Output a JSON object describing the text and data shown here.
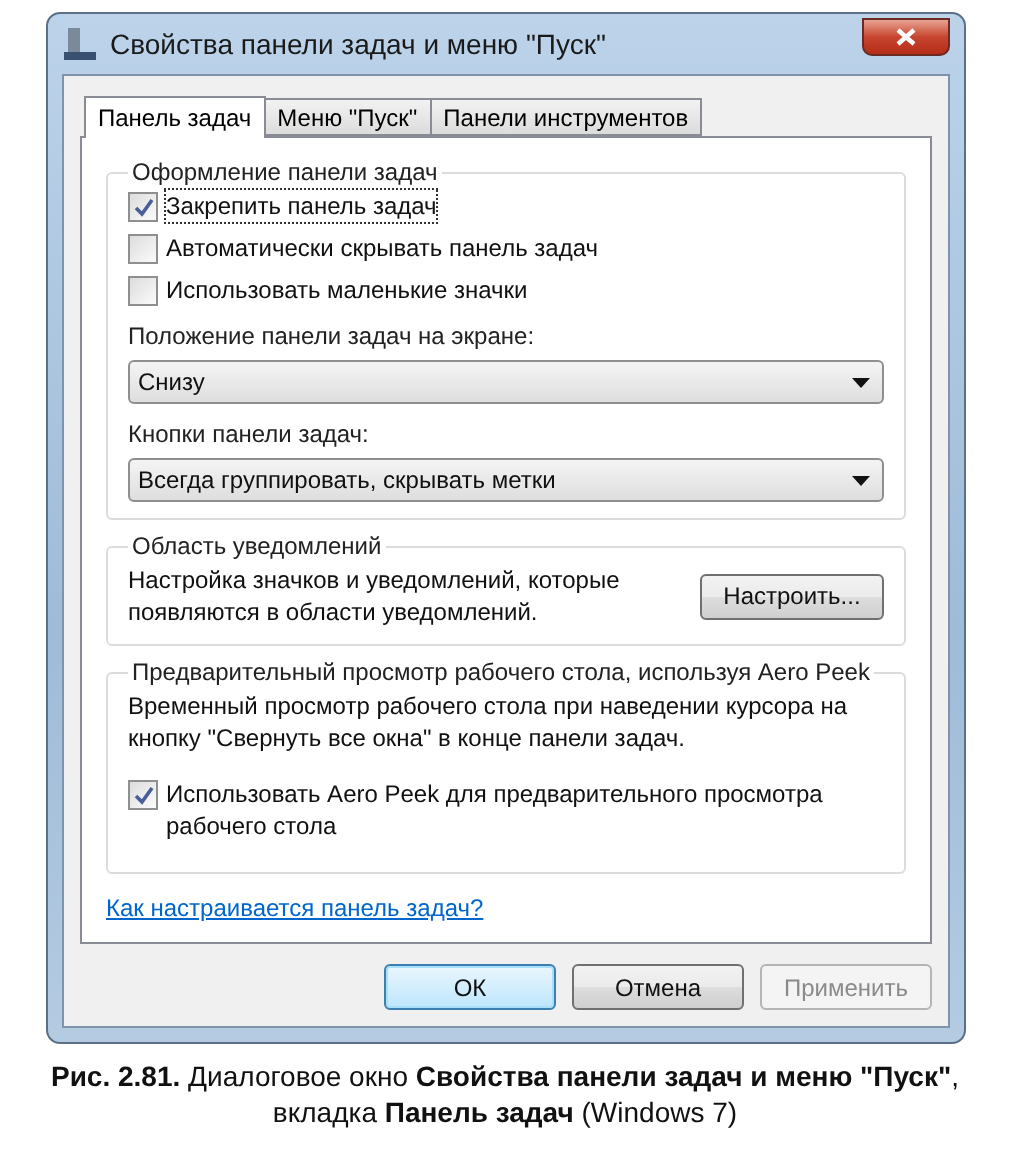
{
  "window": {
    "title": "Свойства панели задач и меню \"Пуск\""
  },
  "tabs": [
    {
      "label": "Панель задач",
      "selected": true
    },
    {
      "label": "Меню \"Пуск\"",
      "selected": false
    },
    {
      "label": "Панели инструментов",
      "selected": false
    }
  ],
  "appearance": {
    "title": "Оформление панели задач",
    "checkboxes": [
      {
        "label": "Закрепить панель задач",
        "checked": true,
        "focused": true
      },
      {
        "label": "Автоматически скрывать панель задач",
        "checked": false,
        "focused": false
      },
      {
        "label": "Использовать маленькие значки",
        "checked": false,
        "focused": false
      }
    ],
    "dropdowns": [
      {
        "label": "Положение панели задач на экране:",
        "value": "Снизу"
      },
      {
        "label": "Кнопки панели задач:",
        "value": "Всегда группировать, скрывать метки"
      }
    ]
  },
  "notifications": {
    "title": "Область уведомлений",
    "text": "Настройка значков и уведомлений, которые появляются в области уведомлений.",
    "button": "Настроить..."
  },
  "peek": {
    "title": "Предварительный просмотр рабочего стола, используя Aero Peek",
    "text": "Временный просмотр рабочего стола при наведении курсора на кнопку \"Свернуть все окна\" в конце панели задач.",
    "checkbox": {
      "label": "Использовать Aero Peek для предварительного просмотра рабочего стола",
      "checked": true
    }
  },
  "help_link": "Как настраивается панель задач?",
  "buttons": [
    {
      "label": "ОК",
      "default": true,
      "disabled": false
    },
    {
      "label": "Отмена",
      "default": false,
      "disabled": false
    },
    {
      "label": "Применить",
      "default": false,
      "disabled": true
    }
  ],
  "caption": "**Рис. 2.81.** Диалоговое окно **Свойства панели задач и меню \"Пуск\"**, вкладка **Панель задач** (Windows 7)"
}
